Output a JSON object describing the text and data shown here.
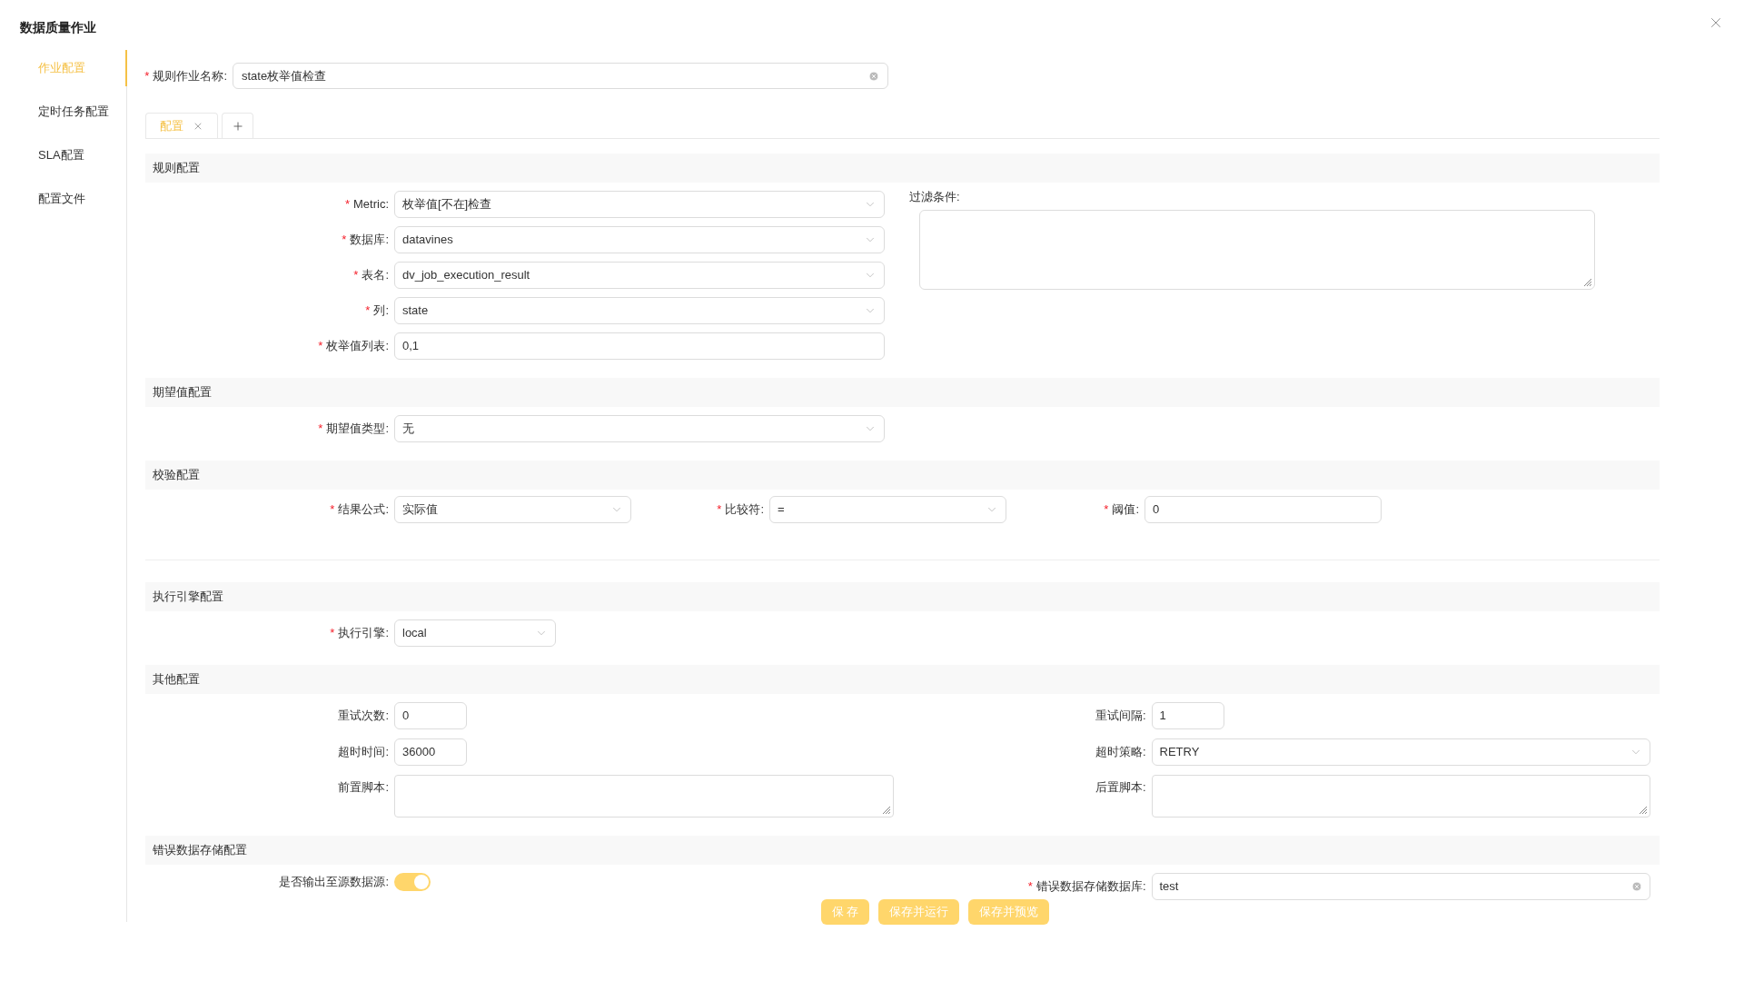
{
  "dialog": {
    "title": "数据质量作业"
  },
  "sidebar": {
    "items": [
      {
        "label": "作业配置",
        "selected": true
      },
      {
        "label": "定时任务配置",
        "selected": false
      },
      {
        "label": "SLA配置",
        "selected": false
      },
      {
        "label": "配置文件",
        "selected": false
      }
    ]
  },
  "job_name": {
    "label": "规则作业名称:",
    "marker": "*",
    "value": "state枚举值检查",
    "clearable": true
  },
  "tabs": [
    {
      "label": "配置",
      "selected": true
    }
  ],
  "sections": [
    {
      "kind": "form",
      "title": "规则配置",
      "fields": [
        {
          "kind": "select",
          "label": "Metric:",
          "marker": "*",
          "value": "枚举值[不在]检查"
        },
        {
          "kind": "select",
          "label": "数据库:",
          "marker": "*",
          "value": "datavines"
        },
        {
          "kind": "select",
          "label": "表名:",
          "marker": "*",
          "value": "dv_job_execution_result"
        },
        {
          "kind": "select",
          "label": "列:",
          "marker": "*",
          "value": "state"
        },
        {
          "kind": "input",
          "label": "枚举值列表:",
          "marker": "*",
          "value": "0,1"
        }
      ],
      "aside": {
        "label": "过滤条件:"
      }
    },
    {
      "kind": "form",
      "title": "期望值配置",
      "fields": [
        {
          "kind": "select",
          "label": "期望值类型:",
          "marker": "*",
          "value": "无"
        }
      ]
    },
    {
      "kind": "inline",
      "title": "校验配置",
      "fields": [
        {
          "kind": "select",
          "label": "结果公式:",
          "marker": "*",
          "value": "实际值"
        },
        {
          "kind": "select",
          "label": "比较符:",
          "marker": "*",
          "value": "="
        },
        {
          "kind": "input",
          "label": "阈值:",
          "marker": "*",
          "value": "0"
        }
      ]
    },
    {
      "kind": "form",
      "title": "执行引擎配置",
      "fields": [
        {
          "kind": "short_select",
          "label": "执行引擎:",
          "marker": "*",
          "value": "local"
        }
      ]
    },
    {
      "kind": "split",
      "title": "其他配置",
      "columns": [
        [
          {
            "kind": "short_input",
            "label": "重试次数:",
            "value": "0"
          },
          {
            "kind": "short_input",
            "label": "超时时间:",
            "value": "36000"
          },
          {
            "kind": "textarea_small",
            "label": "前置脚本:"
          }
        ],
        [
          {
            "kind": "short_input",
            "label": "重试间隔:",
            "value": "1"
          },
          {
            "kind": "select",
            "label": "超时策略:",
            "value": "RETRY"
          },
          {
            "kind": "textarea_small",
            "label": "后置脚本:"
          }
        ]
      ]
    },
    {
      "kind": "split",
      "title": "错误数据存储配置",
      "columns": [
        [
          {
            "kind": "switch",
            "label": "是否输出至源数据源:",
            "on": true
          }
        ],
        [
          {
            "kind": "input",
            "label": "错误数据存储数据库:",
            "marker": "*",
            "value": "test",
            "clearable": true
          }
        ]
      ]
    }
  ],
  "buttons": [
    "保 存",
    "保存并运行",
    "保存并预览"
  ]
}
